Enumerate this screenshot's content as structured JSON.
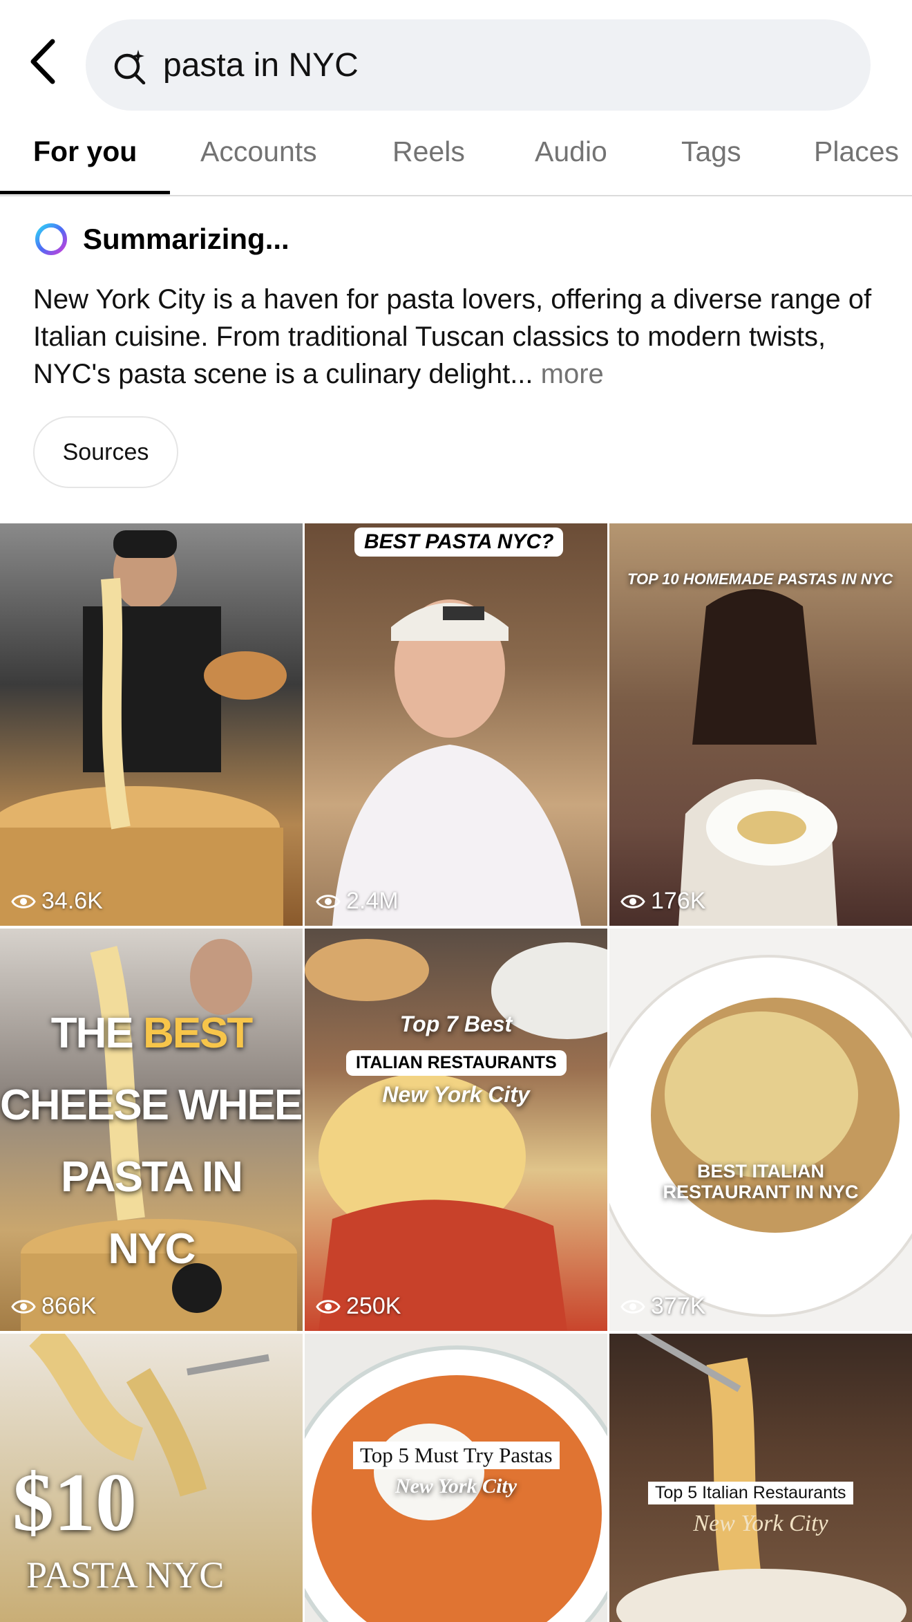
{
  "search": {
    "value": "pasta in NYC"
  },
  "tabs": [
    {
      "label": "For you",
      "active": true
    },
    {
      "label": "Accounts",
      "active": false
    },
    {
      "label": "Reels",
      "active": false
    },
    {
      "label": "Audio",
      "active": false
    },
    {
      "label": "Tags",
      "active": false
    },
    {
      "label": "Places",
      "active": false
    }
  ],
  "ai": {
    "status": "Summarizing...",
    "summary": "New York City is a haven for pasta lovers, offering a diverse range of Italian cuisine. From traditional Tuscan classics to modern twists, NYC's pasta scene is a culinary delight...",
    "more_label": "more",
    "sources_label": "Sources"
  },
  "colors": {
    "active_tab": "#000000",
    "inactive_tab": "#737373",
    "search_bg": "#eff1f4"
  },
  "grid": [
    {
      "views": "34.6K",
      "overlay": []
    },
    {
      "views": "2.4M",
      "overlay": [
        "BEST PASTA NYC?"
      ]
    },
    {
      "views": "176K",
      "overlay": [
        "TOP 10 HOMEMADE PASTAS IN NYC"
      ]
    },
    {
      "views": "866K",
      "overlay": [
        "THE",
        "BEST",
        "CHEESE WHEEL",
        "PASTA IN",
        "NYC"
      ]
    },
    {
      "views": "250K",
      "overlay": [
        "Top 7 Best",
        "ITALIAN RESTAURANTS",
        "New York City"
      ]
    },
    {
      "views": "377K",
      "overlay": [
        "BEST ITALIAN",
        "RESTAURANT IN NYC"
      ]
    },
    {
      "views": "",
      "overlay": [
        "$10",
        "PASTA NYC"
      ]
    },
    {
      "views": "",
      "overlay": [
        "Top 5 Must Try Pastas",
        "New York City"
      ]
    },
    {
      "views": "",
      "overlay": [
        "Top 5 Italian Restaurants",
        "New York City"
      ]
    }
  ]
}
